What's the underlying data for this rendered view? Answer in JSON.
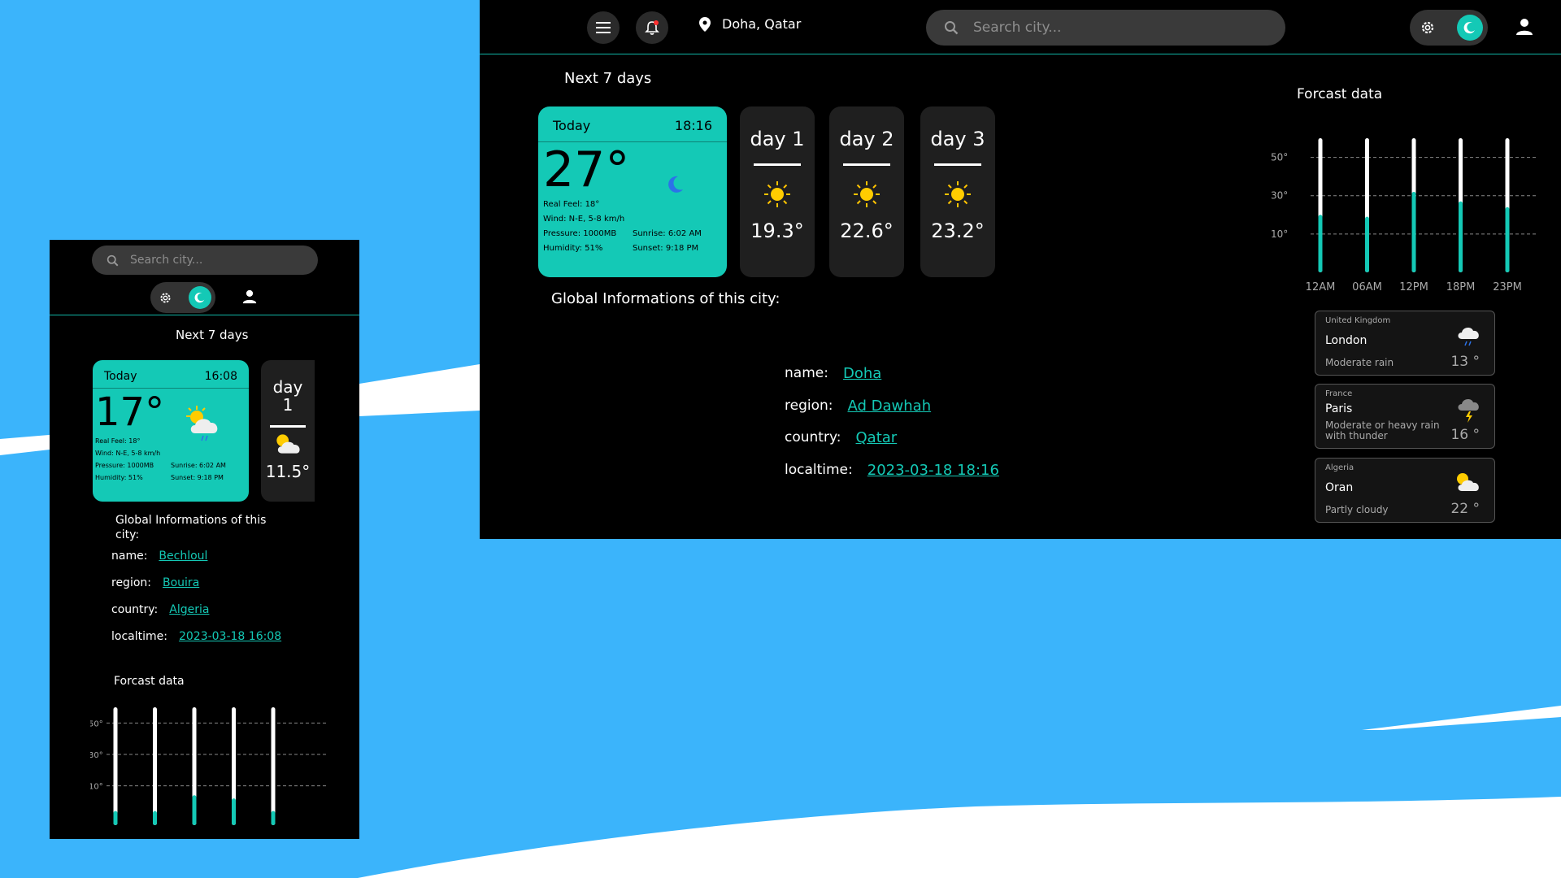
{
  "desktop": {
    "location": "Doha, Qatar",
    "search_placeholder": "Search city...",
    "next_days_title": "Next 7 days",
    "today": {
      "label": "Today",
      "time": "18:16",
      "temp": "27°",
      "real_feel": "Real Feel: 18°",
      "wind": "Wind: N-E, 5-8 km/h",
      "pressure": "Pressure: 1000MB",
      "humidity": "Humidity: 51%",
      "sunrise": "Sunrise: 6:02 AM",
      "sunset": "Sunset: 9:18 PM",
      "icon": "moon-icon"
    },
    "days": [
      {
        "name": "day 1",
        "temp": "19.3°",
        "icon": "sun-icon"
      },
      {
        "name": "day 2",
        "temp": "22.6°",
        "icon": "sun-icon"
      },
      {
        "name": "day 3",
        "temp": "23.2°",
        "icon": "sun-icon"
      }
    ],
    "global_title": "Global Informations of this city:",
    "info": {
      "name_label": "name:",
      "name_value": "Doha",
      "region_label": "region:",
      "region_value": "Ad Dawhah",
      "country_label": "country:",
      "country_value": "Qatar",
      "localtime_label": "localtime:",
      "localtime_value": "2023-03-18 18:16"
    },
    "forecast_title": "Forcast data",
    "cities": [
      {
        "country": "United Kingdom",
        "city": "London",
        "desc": "Moderate rain",
        "temp": "13 °",
        "icon": "rain-cloud-icon"
      },
      {
        "country": "France",
        "city": "Paris",
        "desc": "Moderate or heavy rain with thunder",
        "temp": "16 °",
        "icon": "thunder-cloud-icon"
      },
      {
        "country": "Algeria",
        "city": "Oran",
        "desc": "Partly cloudy",
        "temp": "22 °",
        "icon": "partly-cloudy-icon"
      }
    ]
  },
  "mobile": {
    "search_placeholder": "Search city...",
    "next_days_title": "Next 7 days",
    "today": {
      "label": "Today",
      "time": "16:08",
      "temp": "17°",
      "real_feel": "Real Feel: 18°",
      "wind": "Wind: N-E, 5-8 km/h",
      "pressure": "Pressure: 1000MB",
      "humidity": "Humidity: 51%",
      "sunrise": "Sunrise: 6:02 AM",
      "sunset": "Sunset: 9:18 PM",
      "icon": "partly-cloudy-rain-icon"
    },
    "day": {
      "name_top": "day",
      "name_bottom": "1",
      "temp": "11.5°",
      "icon": "partly-cloudy-icon"
    },
    "global_title_line1": "Global Informations of this",
    "global_title_line2": "city:",
    "info": {
      "name_label": "name:",
      "name_value": "Bechloul",
      "region_label": "region:",
      "region_value": "Bouira",
      "country_label": "country:",
      "country_value": "Algeria",
      "localtime_label": "localtime:",
      "localtime_value": "2023-03-18 16:08"
    },
    "forecast_title": "Forcast data"
  },
  "colors": {
    "accent": "#14c9b6",
    "background": "#3bb4fb",
    "panel": "#000000",
    "card": "#1f1f1f"
  },
  "chart_data": [
    {
      "type": "bar",
      "id": "desktop-forecast",
      "categories": [
        "12AM",
        "06AM",
        "12PM",
        "18PM",
        "23PM"
      ],
      "values": [
        20,
        19,
        32,
        27,
        24
      ],
      "ytick_labels": [
        "50°",
        "30°",
        "10°"
      ],
      "ylim": [
        -10,
        60
      ],
      "grid": "dashed horizontal"
    },
    {
      "type": "bar",
      "id": "mobile-forecast",
      "categories": [
        "",
        "",
        "",
        "",
        ""
      ],
      "values": [
        -6,
        -6,
        4,
        2,
        -6
      ],
      "ytick_labels": [
        "50°",
        "30°",
        "10°"
      ],
      "ylim": [
        -15,
        60
      ],
      "grid": "dashed horizontal"
    }
  ]
}
